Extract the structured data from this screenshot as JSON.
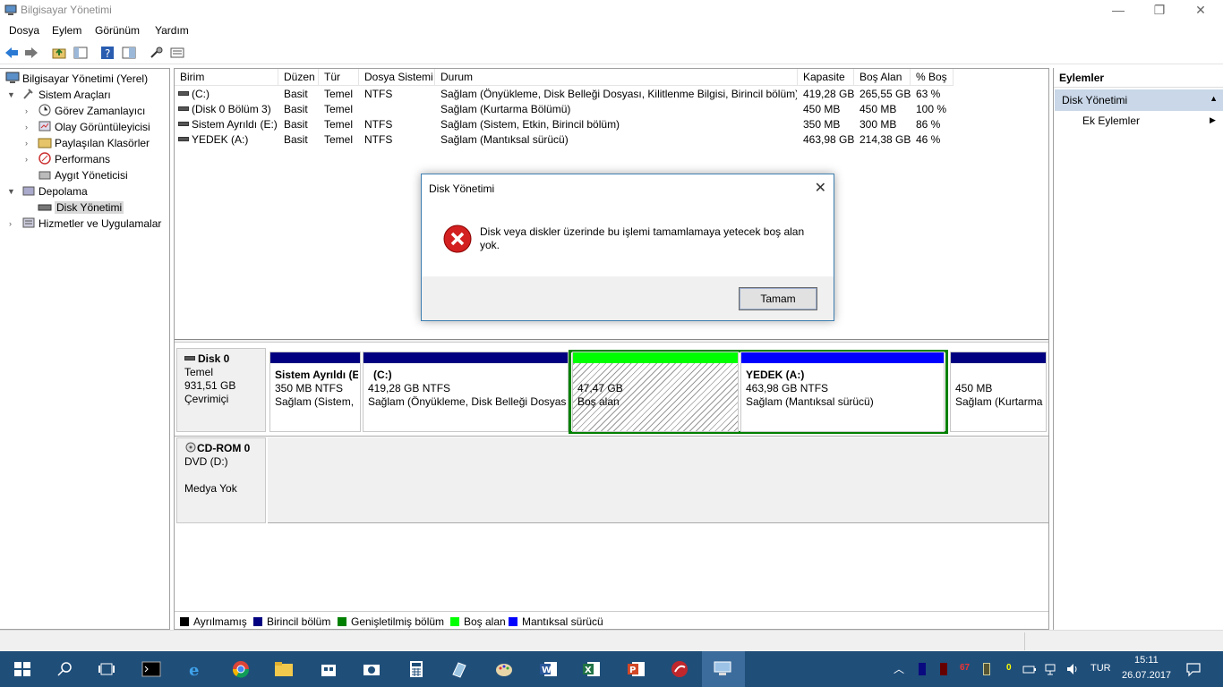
{
  "window": {
    "title": "Bilgisayar Yönetimi"
  },
  "menu": [
    "Dosya",
    "Eylem",
    "Görünüm",
    "Yardım"
  ],
  "tree": {
    "root": "Bilgisayar Yönetimi (Yerel)",
    "items": [
      "Sistem Araçları",
      "Görev Zamanlayıcı",
      "Olay Görüntüleyicisi",
      "Paylaşılan Klasörler",
      "Performans",
      "Aygıt Yöneticisi",
      "Depolama",
      "Disk Yönetimi",
      "Hizmetler ve Uygulamalar"
    ]
  },
  "volumes": {
    "columns": [
      "Birim",
      "Düzen",
      "Tür",
      "Dosya Sistemi",
      "Durum",
      "Kapasite",
      "Boş Alan",
      "% Boş"
    ],
    "rows": [
      [
        "(C:)",
        "Basit",
        "Temel",
        "NTFS",
        "Sağlam (Önyükleme, Disk Belleği Dosyası, Kilitlenme Bilgisi, Birincil bölüm)",
        "419,28 GB",
        "265,55 GB",
        "63 %"
      ],
      [
        "(Disk 0 Bölüm 3)",
        "Basit",
        "Temel",
        "",
        "Sağlam (Kurtarma Bölümü)",
        "450 MB",
        "450 MB",
        "100 %"
      ],
      [
        "Sistem Ayrıldı (E:)",
        "Basit",
        "Temel",
        "NTFS",
        "Sağlam (Sistem, Etkin, Birincil bölüm)",
        "350 MB",
        "300 MB",
        "86 %"
      ],
      [
        "YEDEK (A:)",
        "Basit",
        "Temel",
        "NTFS",
        "Sağlam (Mantıksal sürücü)",
        "463,98 GB",
        "214,38 GB",
        "46 %"
      ]
    ]
  },
  "disk0": {
    "name": "Disk 0",
    "type": "Temel",
    "size": "931,51 GB",
    "status": "Çevrimiçi"
  },
  "cdrom": {
    "name": "CD-ROM 0",
    "drive": "DVD (D:)",
    "status": "Medya Yok"
  },
  "partitions": [
    {
      "name": "Sistem Ayrıldı  (E",
      "size": "350 MB NTFS",
      "status": "Sağlam (Sistem,",
      "color": "#000080"
    },
    {
      "name": "(C:)",
      "size": "419,28 GB NTFS",
      "status": "Sağlam (Önyükleme, Disk Belleği Dosyası",
      "color": "#000080"
    },
    {
      "name": "",
      "size": "47,47 GB",
      "status": "Boş alan",
      "color": "#00ff00"
    },
    {
      "name": "YEDEK  (A:)",
      "size": "463,98 GB NTFS",
      "status": "Sağlam (Mantıksal sürücü)",
      "color": "#0000ff"
    },
    {
      "name": "",
      "size": "450 MB",
      "status": "Sağlam (Kurtarma",
      "color": "#000080"
    }
  ],
  "legend": [
    {
      "label": "Ayrılmamış",
      "color": "#000000"
    },
    {
      "label": "Birincil bölüm",
      "color": "#000080"
    },
    {
      "label": "Genişletilmiş bölüm",
      "color": "#008000"
    },
    {
      "label": "Boş alan",
      "color": "#00ff00"
    },
    {
      "label": "Mantıksal sürücü",
      "color": "#0000ff"
    }
  ],
  "actions": {
    "title": "Eylemler",
    "section": "Disk Yönetimi",
    "item": "Ek Eylemler"
  },
  "dialog": {
    "title": "Disk Yönetimi",
    "message": "Disk veya diskler üzerinde bu işlemi tamamlamaya yetecek boş alan yok.",
    "ok": "Tamam"
  },
  "tray": {
    "lang": "TUR",
    "time": "15:11",
    "date": "26.07.2017",
    "badge1": "67",
    "badge2": "0"
  }
}
